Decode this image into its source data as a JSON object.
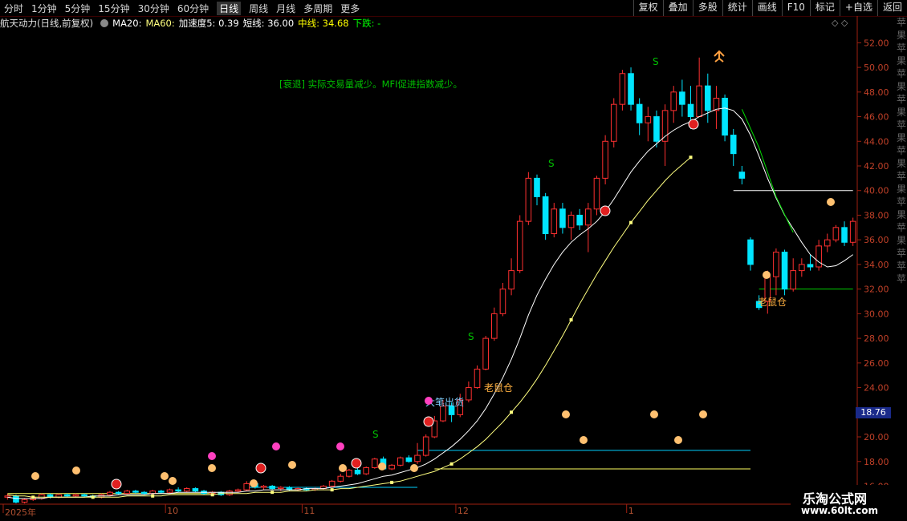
{
  "toolbar": {
    "left": [
      {
        "label": "分时"
      },
      {
        "label": "1分钟"
      },
      {
        "label": "5分钟"
      },
      {
        "label": "15分钟"
      },
      {
        "label": "30分钟"
      },
      {
        "label": "60分钟"
      },
      {
        "label": "日线",
        "active": true
      },
      {
        "label": "周线"
      },
      {
        "label": "月线"
      },
      {
        "label": "多周期"
      },
      {
        "label": "更多"
      }
    ],
    "right": [
      {
        "label": "复权"
      },
      {
        "label": "叠加"
      },
      {
        "label": "多股"
      },
      {
        "label": "统计"
      },
      {
        "label": "画线"
      },
      {
        "label": "F10"
      },
      {
        "label": "标记"
      },
      {
        "label": "+自选"
      },
      {
        "label": "返回"
      }
    ]
  },
  "info": {
    "stock": "航天动力(日线,前复权)",
    "ma20": "MA20:",
    "ma60": "MA60:",
    "accel": "加速度5: 0.39",
    "short": "短线: 36.00",
    "mid": "中线: 34.68",
    "down": "下跌: -"
  },
  "colors": {
    "up": "#ff3030",
    "down": "#00e5ff",
    "ma20": "#ffffff",
    "ma60": "#ffff80",
    "axis": "#b03020",
    "annotation_green": "#00c000",
    "annotation_orange": "#ffb040"
  },
  "annotations": {
    "note": "[衰退] 实际交易量减少。MFI促进指数减少。",
    "big_sell": "大笔出货",
    "rat_1": "老鼠仓",
    "rat_2": "老鼠仓",
    "s_label": "S"
  },
  "axis_badge": "18.76",
  "watermark": {
    "title": "乐淘公式网",
    "url": "www.60lt.com"
  },
  "right_edge_text": "苹果苹果苹果苹果苹果苹果苹果苹果苹果苹苹苹",
  "chart_data": {
    "type": "candlestick",
    "title": "航天动力(日线,前复权)",
    "y_ticks": [
      16,
      18,
      20,
      22,
      24,
      26,
      28,
      30,
      32,
      34,
      36,
      38,
      40,
      42,
      44,
      46,
      48,
      50,
      52
    ],
    "ylim": [
      14.6,
      53.0
    ],
    "x_ticks": [
      {
        "label": "2025年",
        "index": 0
      },
      {
        "label": "10",
        "index": 19
      },
      {
        "label": "11",
        "index": 35
      },
      {
        "label": "12",
        "index": 53
      },
      {
        "label": "1",
        "index": 73
      }
    ],
    "candles": [
      [
        15.1,
        15.2,
        15.4,
        14.9
      ],
      [
        15.2,
        14.7,
        15.3,
        14.6
      ],
      [
        14.7,
        14.9,
        15.0,
        14.6
      ],
      [
        14.9,
        15.1,
        15.2,
        14.8
      ],
      [
        15.0,
        15.3,
        15.4,
        14.9
      ],
      [
        15.3,
        15.1,
        15.4,
        15.0
      ],
      [
        15.1,
        15.3,
        15.4,
        15.0
      ],
      [
        15.3,
        15.2,
        15.4,
        15.1
      ],
      [
        15.2,
        15.3,
        15.4,
        15.1
      ],
      [
        15.3,
        15.2,
        15.4,
        15.1
      ],
      [
        15.2,
        15.1,
        15.3,
        15.0
      ],
      [
        15.1,
        15.3,
        15.4,
        15.0
      ],
      [
        15.3,
        15.5,
        15.6,
        15.2
      ],
      [
        15.5,
        15.4,
        15.6,
        15.3
      ],
      [
        15.4,
        15.6,
        15.7,
        15.3
      ],
      [
        15.6,
        15.5,
        15.7,
        15.4
      ],
      [
        15.5,
        15.4,
        15.6,
        15.3
      ],
      [
        15.4,
        15.6,
        15.7,
        15.3
      ],
      [
        15.6,
        15.5,
        15.7,
        15.4
      ],
      [
        15.5,
        15.7,
        15.8,
        15.4
      ],
      [
        15.7,
        15.6,
        15.9,
        15.5
      ],
      [
        15.6,
        15.8,
        15.9,
        15.5
      ],
      [
        15.8,
        15.6,
        15.9,
        15.5
      ],
      [
        15.6,
        15.4,
        15.7,
        15.3
      ],
      [
        15.4,
        15.5,
        15.6,
        15.2
      ],
      [
        15.5,
        15.3,
        15.6,
        15.2
      ],
      [
        15.3,
        15.6,
        15.7,
        15.2
      ],
      [
        15.6,
        15.7,
        15.8,
        15.5
      ],
      [
        15.7,
        16.2,
        16.4,
        15.6
      ],
      [
        16.2,
        15.9,
        16.3,
        15.8
      ],
      [
        15.9,
        16.0,
        16.1,
        15.7
      ],
      [
        16.0,
        15.8,
        16.1,
        15.7
      ],
      [
        15.8,
        15.9,
        16.0,
        15.6
      ],
      [
        15.9,
        15.7,
        16.0,
        15.6
      ],
      [
        15.7,
        15.8,
        15.9,
        15.6
      ],
      [
        15.8,
        15.7,
        15.9,
        15.6
      ],
      [
        15.7,
        15.8,
        15.9,
        15.6
      ],
      [
        15.8,
        16.0,
        16.1,
        15.7
      ],
      [
        16.0,
        16.4,
        16.5,
        15.9
      ],
      [
        16.4,
        16.8,
        17.0,
        16.3
      ],
      [
        16.8,
        17.3,
        17.4,
        16.7
      ],
      [
        17.3,
        17.0,
        17.5,
        16.9
      ],
      [
        17.0,
        17.5,
        17.6,
        16.9
      ],
      [
        17.5,
        18.2,
        18.3,
        17.4
      ],
      [
        18.2,
        17.4,
        18.4,
        17.3
      ],
      [
        17.4,
        17.7,
        17.8,
        17.3
      ],
      [
        17.7,
        18.3,
        18.4,
        17.6
      ],
      [
        18.3,
        18.0,
        18.5,
        17.9
      ],
      [
        18.0,
        18.5,
        19.5,
        17.8
      ],
      [
        18.5,
        20.0,
        20.2,
        18.4
      ],
      [
        20.0,
        21.3,
        21.7,
        19.9
      ],
      [
        21.3,
        22.5,
        23.0,
        21.2
      ],
      [
        22.5,
        21.8,
        22.8,
        21.2
      ],
      [
        21.8,
        23.0,
        23.5,
        21.6
      ],
      [
        23.0,
        24.0,
        24.5,
        22.8
      ],
      [
        24.0,
        25.5,
        25.8,
        23.9
      ],
      [
        25.5,
        28.0,
        28.2,
        25.4
      ],
      [
        28.0,
        30.0,
        30.5,
        27.8
      ],
      [
        30.0,
        32.0,
        32.5,
        29.8
      ],
      [
        32.0,
        33.5,
        34.5,
        31.5
      ],
      [
        33.5,
        37.5,
        38.0,
        33.3
      ],
      [
        37.5,
        41.0,
        41.5,
        37.2
      ],
      [
        41.0,
        39.5,
        41.3,
        38.8
      ],
      [
        39.5,
        36.5,
        39.8,
        36.0
      ],
      [
        36.5,
        38.5,
        39.0,
        36.2
      ],
      [
        38.5,
        37.0,
        39.0,
        36.5
      ],
      [
        37.0,
        38.0,
        38.3,
        36.0
      ],
      [
        38.0,
        37.2,
        38.5,
        36.8
      ],
      [
        37.2,
        38.5,
        39.0,
        35.0
      ],
      [
        38.5,
        41.0,
        41.2,
        38.0
      ],
      [
        41.0,
        44.0,
        44.5,
        40.5
      ],
      [
        44.0,
        47.0,
        47.5,
        43.5
      ],
      [
        47.0,
        49.5,
        49.8,
        46.5
      ],
      [
        49.5,
        47.0,
        50.0,
        46.5
      ],
      [
        47.0,
        45.5,
        47.5,
        44.5
      ],
      [
        45.5,
        46.0,
        46.8,
        44.0
      ],
      [
        46.0,
        44.0,
        46.5,
        43.5
      ],
      [
        44.0,
        46.5,
        47.0,
        42.0
      ],
      [
        46.5,
        48.0,
        48.5,
        45.5
      ],
      [
        48.0,
        47.0,
        49.0,
        46.0
      ],
      [
        47.0,
        46.0,
        48.5,
        45.0
      ],
      [
        46.0,
        48.5,
        50.8,
        46.0
      ],
      [
        48.5,
        46.5,
        49.5,
        45.5
      ],
      [
        46.5,
        47.5,
        48.5,
        45.0
      ],
      [
        47.5,
        44.5,
        47.8,
        44.0
      ],
      [
        44.5,
        43.0,
        45.0,
        42.0
      ],
      [
        41.5,
        41.0,
        42.0,
        40.5
      ],
      [
        36.0,
        34.0,
        36.2,
        33.5
      ],
      [
        31.0,
        30.5,
        31.5,
        30.3
      ],
      [
        31.0,
        33.0,
        33.5,
        30.0
      ],
      [
        33.0,
        35.0,
        35.3,
        31.5
      ],
      [
        35.0,
        32.0,
        35.2,
        31.5
      ],
      [
        32.0,
        33.5,
        34.5,
        31.8
      ],
      [
        33.5,
        34.0,
        34.5,
        33.0
      ],
      [
        34.0,
        33.8,
        34.8,
        33.5
      ],
      [
        33.8,
        35.5,
        36.0,
        33.5
      ],
      [
        35.5,
        36.0,
        36.5,
        35.0
      ],
      [
        36.0,
        37.0,
        37.2,
        35.8
      ],
      [
        37.0,
        35.8,
        37.5,
        35.5
      ],
      [
        35.8,
        37.5,
        37.8,
        35.5
      ]
    ],
    "series": [
      {
        "name": "MA20",
        "values_from_index": 0,
        "values": [
          15.1,
          15.0,
          15.0,
          15.0,
          15.0,
          15.1,
          15.1,
          15.1,
          15.1,
          15.1,
          15.2,
          15.2,
          15.2,
          15.3,
          15.3,
          15.3,
          15.3,
          15.4,
          15.4,
          15.4,
          15.5,
          15.5,
          15.5,
          15.5,
          15.5,
          15.5,
          15.5,
          15.5,
          15.6,
          15.6,
          15.7,
          15.7,
          15.7,
          15.7,
          15.7,
          15.8,
          15.8,
          15.8,
          15.9,
          16.0,
          16.1,
          16.2,
          16.4,
          16.6,
          16.8,
          16.9,
          17.1,
          17.3,
          17.5,
          17.8,
          18.2,
          18.7,
          19.2,
          19.8,
          20.5,
          21.3,
          22.3,
          23.5,
          24.8,
          26.3,
          28.0,
          29.9,
          31.5,
          32.8,
          34.0,
          35.0,
          35.8,
          36.4,
          36.9,
          37.5,
          38.3,
          39.3,
          40.4,
          41.5,
          42.4,
          43.2,
          43.8,
          44.4,
          44.9,
          45.3,
          45.6,
          46.0,
          46.3,
          46.6,
          46.7,
          46.5,
          45.8,
          44.5,
          42.8,
          41.0,
          39.4,
          38.0,
          36.9,
          35.8,
          34.8,
          34.2,
          33.8,
          33.9,
          34.3,
          34.8
        ]
      },
      {
        "name": "MA60",
        "values_from_index": 0,
        "values": [
          15.3,
          15.2,
          15.2,
          15.1,
          15.1,
          15.1,
          15.1,
          15.1,
          15.1,
          15.1,
          15.1,
          15.1,
          15.1,
          15.1,
          15.2,
          15.2,
          15.2,
          15.2,
          15.2,
          15.3,
          15.3,
          15.3,
          15.3,
          15.3,
          15.3,
          15.4,
          15.4,
          15.4,
          15.4,
          15.5,
          15.5,
          15.5,
          15.5,
          15.6,
          15.6,
          15.6,
          15.7,
          15.7,
          15.7,
          15.8,
          15.8,
          15.9,
          16.0,
          16.1,
          16.2,
          16.3,
          16.4,
          16.6,
          16.8,
          17.0,
          17.2,
          17.5,
          17.8,
          18.2,
          18.7,
          19.2,
          19.8,
          20.5,
          21.2,
          22.0,
          22.8,
          23.7,
          24.7,
          25.8,
          27.0,
          28.2,
          29.5,
          30.8,
          32.0,
          33.2,
          34.3,
          35.4,
          36.4,
          37.4,
          38.3,
          39.2,
          40.0,
          40.8,
          41.5,
          42.1,
          42.7
        ]
      }
    ],
    "hlines": [
      {
        "y": 40.0,
        "from": 85,
        "to": 99,
        "color": "#ffffff"
      },
      {
        "y": 32.0,
        "from": 88,
        "to": 99,
        "color": "#00d000"
      },
      {
        "y": 18.9,
        "from": 48,
        "to": 87,
        "color": "#00d0ff"
      },
      {
        "y": 17.4,
        "from": 50,
        "to": 87,
        "color": "#ffff60"
      },
      {
        "y": 15.4,
        "from": 0,
        "to": 24,
        "color": "#ffff60"
      },
      {
        "y": 15.9,
        "from": 28,
        "to": 48,
        "color": "#00d0ff"
      }
    ]
  }
}
